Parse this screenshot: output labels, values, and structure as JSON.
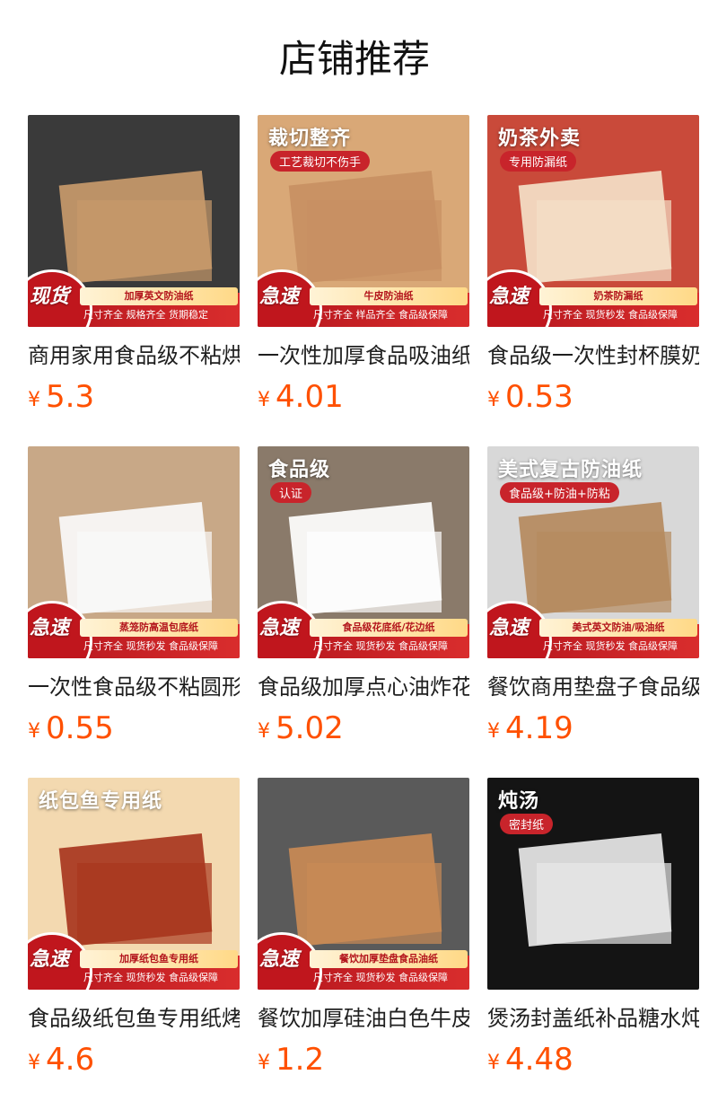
{
  "page": {
    "title": "店铺推荐"
  },
  "currency": "¥",
  "products": [
    {
      "name": "商用家用食品级不粘烘焙英文防油纸",
      "price": "5.3",
      "image": {
        "bg": "#3a3a3a",
        "accent": "#c89a6b",
        "headline": "",
        "sub": "",
        "tag": "加厚英文防油纸",
        "badge": "现货",
        "perks": "尺寸齐全  规格齐全  货期稳定"
      }
    },
    {
      "name": "一次性加厚食品吸油纸牛皮防油纸",
      "price": "4.01",
      "image": {
        "bg": "#d9a877",
        "accent": "#c89063",
        "headline": "裁切整齐",
        "sub": "工艺裁切不伤手",
        "tag": "牛皮防油纸",
        "badge": "急速",
        "perks": "尺寸齐全  样品齐全  食品级保障"
      }
    },
    {
      "name": "食品级一次性封杯膜奶茶防漏纸",
      "price": "0.53",
      "image": {
        "bg": "#c94a3a",
        "accent": "#f4e0c8",
        "headline": "奶茶外卖",
        "sub": "专用防漏纸",
        "tag": "奶茶防漏纸",
        "badge": "急速",
        "perks": "尺寸齐全  现货秒发  食品级保障"
      }
    },
    {
      "name": "一次性食品级不粘圆形蒸笼纸",
      "price": "0.55",
      "image": {
        "bg": "#c8a887",
        "accent": "#fafafa",
        "headline": "",
        "sub": "",
        "tag": "蒸笼防高温包底纸",
        "badge": "急速",
        "perks": "尺寸齐全  现货秒发  食品级保障"
      }
    },
    {
      "name": "食品级加厚点心油炸花底纸",
      "price": "5.02",
      "image": {
        "bg": "#8a7a6a",
        "accent": "#ffffff",
        "headline": "食品级",
        "sub": "认证",
        "tag": "食品级花底纸/花边纸",
        "badge": "急速",
        "perks": "尺寸齐全  现货秒发  食品级保障"
      }
    },
    {
      "name": "餐饮商用垫盘子食品级防油纸",
      "price": "4.19",
      "image": {
        "bg": "#d8d8d8",
        "accent": "#b58a5e",
        "headline": "美式复古防油纸",
        "sub": "食品级+防油+防粘",
        "tag": "美式英文防油/吸油纸",
        "badge": "急速",
        "perks": "尺寸齐全  现货秒发  食品级保障"
      }
    },
    {
      "name": "食品级纸包鱼专用纸烤鱼纸",
      "price": "4.6",
      "image": {
        "bg": "#f3d9b0",
        "accent": "#a8361e",
        "headline": "纸包鱼专用纸",
        "sub": "",
        "tag": "加厚纸包鱼专用纸",
        "badge": "急速",
        "perks": "尺寸齐全  现货秒发  食品级保障"
      }
    },
    {
      "name": "餐饮加厚硅油白色牛皮垫盘纸",
      "price": "1.2",
      "image": {
        "bg": "#5a5a5a",
        "accent": "#c98a55",
        "headline": "",
        "sub": "",
        "tag": "餐饮加厚垫盘食品油纸",
        "badge": "急速",
        "perks": "尺寸齐全  现货秒发  食品级保障"
      }
    },
    {
      "name": "煲汤封盖纸补品糖水炖盅密封纸",
      "price": "4.48",
      "image": {
        "bg": "#141414",
        "accent": "#e8e8e8",
        "headline": "炖汤",
        "sub": "密封纸",
        "tag": "",
        "badge": "",
        "perks": ""
      }
    }
  ]
}
